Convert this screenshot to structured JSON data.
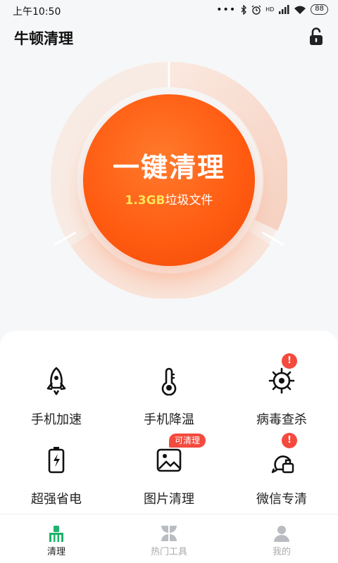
{
  "status_bar": {
    "time": "上午10:50",
    "signal_label": "HD",
    "battery": "88"
  },
  "header": {
    "title": "牛顿清理",
    "lock_icon": "unlock-icon"
  },
  "hero": {
    "button_label": "一键清理",
    "junk_size": "1.3GB",
    "junk_text": "垃圾文件",
    "accent_color": "#ff5a10",
    "size_color": "#ffe45a"
  },
  "tools": [
    {
      "label": "手机加速",
      "icon": "rocket-icon"
    },
    {
      "label": "手机降温",
      "icon": "thermometer-icon"
    },
    {
      "label": "病毒查杀",
      "icon": "virus-icon",
      "badge": "!"
    },
    {
      "label": "超强省电",
      "icon": "battery-icon"
    },
    {
      "label": "图片清理",
      "icon": "image-icon",
      "badge": "可清理"
    },
    {
      "label": "微信专清",
      "icon": "wechat-clean-icon",
      "badge": "!"
    }
  ],
  "badge_color": "#f44a3e",
  "bottom_nav": [
    {
      "label": "清理",
      "icon": "broom-icon",
      "active": true
    },
    {
      "label": "热门工具",
      "icon": "grid-icon",
      "active": false
    },
    {
      "label": "我的",
      "icon": "user-icon",
      "active": false
    }
  ],
  "nav_active_color": "#1fb36b"
}
